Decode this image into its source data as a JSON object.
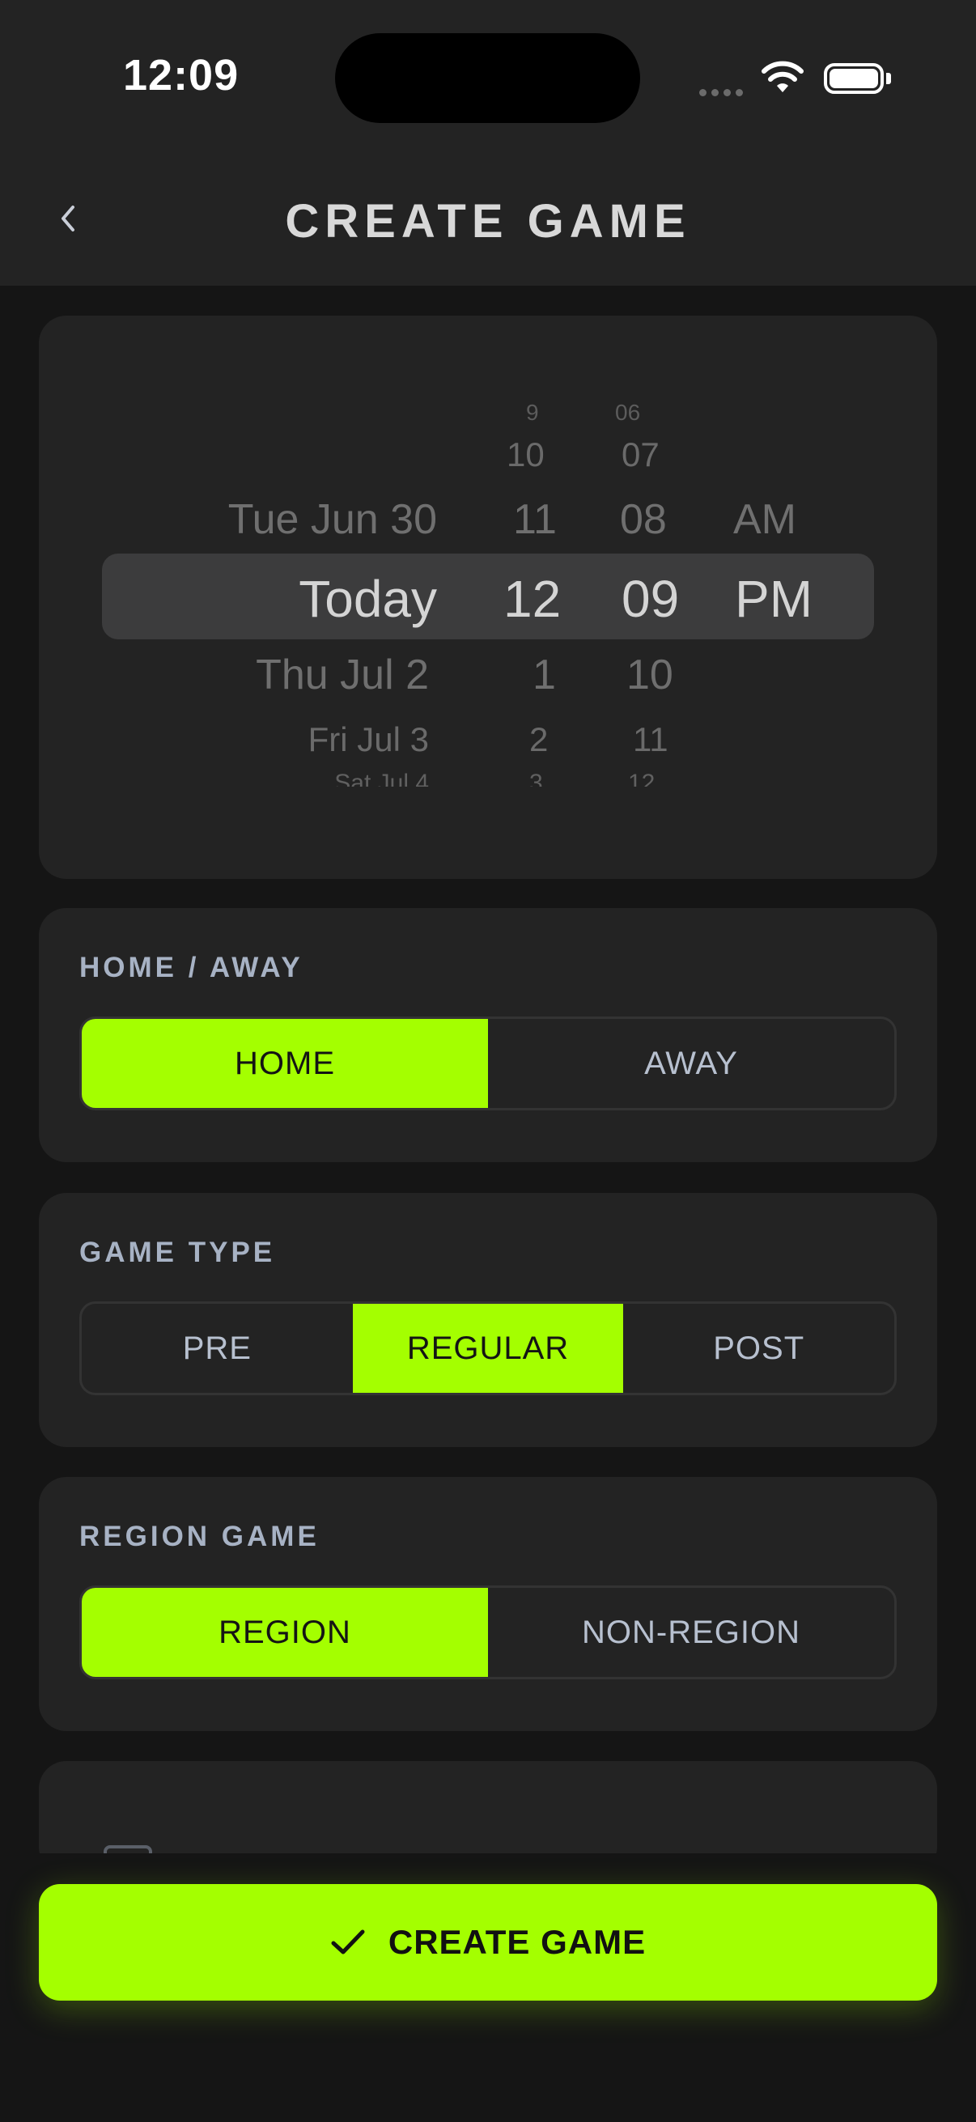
{
  "status_bar": {
    "time": "12:09"
  },
  "nav": {
    "title": "CREATE GAME"
  },
  "picker": {
    "dates": [
      "Tue Jun 30",
      "Today",
      "Thu Jul 2",
      "Fri Jul 3",
      "Sat Jul 4"
    ],
    "hours": [
      "9",
      "10",
      "11",
      "12",
      "1",
      "2",
      "3"
    ],
    "minutes": [
      "06",
      "07",
      "08",
      "09",
      "10",
      "11",
      "12"
    ],
    "periods": [
      "AM",
      "PM"
    ],
    "selected": {
      "date": "Today",
      "hour": "12",
      "minute": "09",
      "period": "PM"
    }
  },
  "home_away": {
    "label": "HOME / AWAY",
    "options": [
      "HOME",
      "AWAY"
    ],
    "selected": "HOME"
  },
  "game_type": {
    "label": "GAME TYPE",
    "options": [
      "PRE",
      "REGULAR",
      "POST"
    ],
    "selected": "REGULAR"
  },
  "region_game": {
    "label": "REGION GAME",
    "options": [
      "REGION",
      "NON-REGION"
    ],
    "selected": "REGION"
  },
  "cta": {
    "label": "CREATE GAME",
    "icon": "checkmark-icon"
  },
  "colors": {
    "accent": "#a4ff00",
    "background": "#151515",
    "card": "#232323"
  }
}
